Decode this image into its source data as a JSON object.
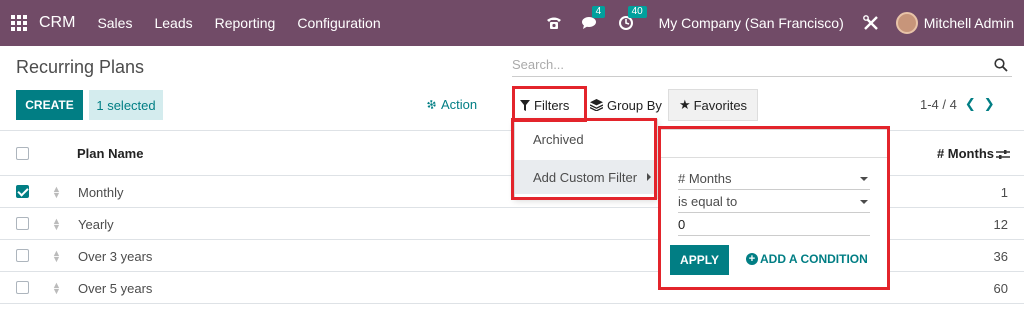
{
  "navbar": {
    "brand": "CRM",
    "menu": [
      "Sales",
      "Leads",
      "Reporting",
      "Configuration"
    ],
    "messages_count": "4",
    "activities_count": "40",
    "company": "My Company (San Francisco)",
    "user": "Mitchell Admin"
  },
  "page": {
    "title": "Recurring Plans",
    "search_placeholder": "Search...",
    "create_label": "CREATE",
    "selected_label": "1 selected",
    "action_label": "Action",
    "filters_label": "Filters",
    "groupby_label": "Group By",
    "favorites_label": "Favorites",
    "pager": "1-4 / 4"
  },
  "list": {
    "columns": [
      "Plan Name",
      "# Months"
    ],
    "rows": [
      {
        "name": "Monthly",
        "months": "1",
        "checked": true
      },
      {
        "name": "Yearly",
        "months": "12",
        "checked": false
      },
      {
        "name": "Over 3 years",
        "months": "36",
        "checked": false
      },
      {
        "name": "Over 5 years",
        "months": "60",
        "checked": false
      }
    ]
  },
  "filter_menu": {
    "archived": "Archived",
    "add_custom_filter": "Add Custom Filter"
  },
  "custom_filter": {
    "field": "# Months",
    "operator": "is equal to",
    "value": "0",
    "apply_label": "APPLY",
    "add_condition_label": "ADD A CONDITION"
  },
  "colors": {
    "navbar": "#714b67",
    "primary": "#017e84",
    "highlight": "#e3242b"
  }
}
